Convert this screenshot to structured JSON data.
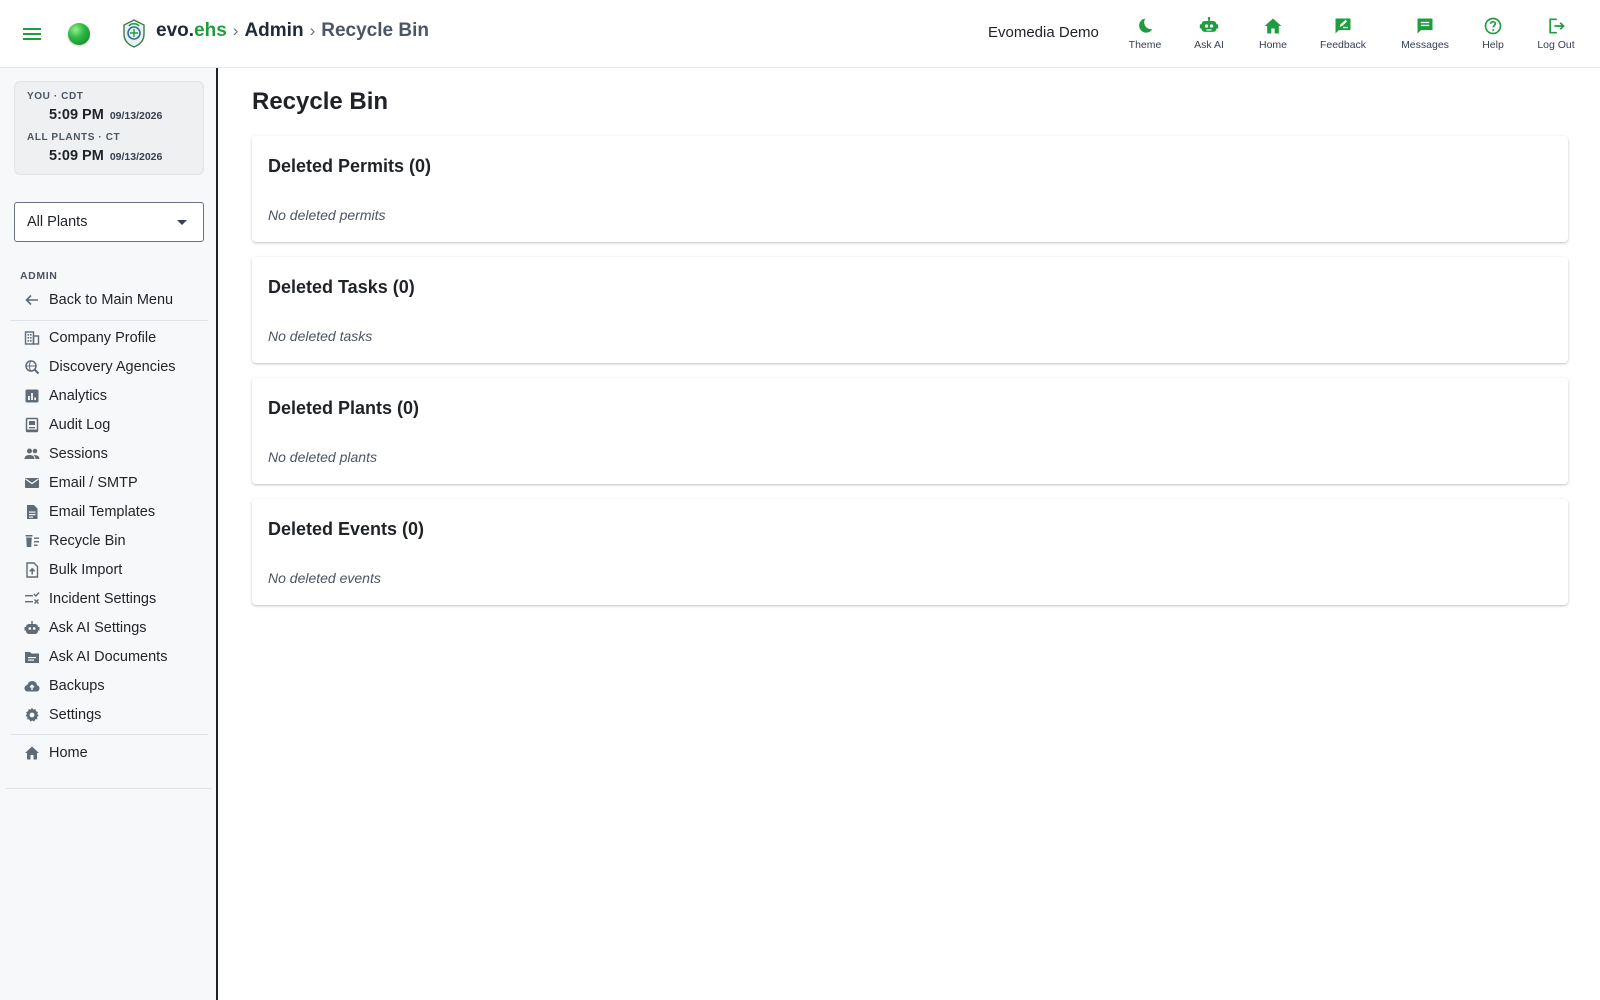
{
  "header": {
    "brand_primary": "evo.",
    "brand_accent": "ehs",
    "crumb_separator": "›",
    "breadcrumb": [
      "Admin",
      "Recycle Bin"
    ],
    "account": "Evomedia Demo",
    "actions": [
      {
        "label": "Theme",
        "icon": "moon-icon"
      },
      {
        "label": "Ask AI",
        "icon": "robot-icon"
      },
      {
        "label": "Home",
        "icon": "home-icon"
      },
      {
        "label": "Feedback",
        "icon": "feedback-icon"
      },
      {
        "label": "Messages",
        "icon": "message-icon"
      },
      {
        "label": "Help",
        "icon": "help-icon"
      },
      {
        "label": "Log Out",
        "icon": "logout-icon"
      }
    ]
  },
  "clock": {
    "you_label": "YOU · CDT",
    "you_time": "5:09 PM",
    "you_date": "09/13/2026",
    "plants_label": "ALL PLANTS · CT",
    "plants_time": "5:09 PM",
    "plants_date": "09/13/2026"
  },
  "plant_select": {
    "value": "All Plants"
  },
  "sidebar": {
    "section_label": "ADMIN",
    "back_label": "Back to Main Menu",
    "items": [
      {
        "label": "Company Profile",
        "icon": "building-icon"
      },
      {
        "label": "Discovery Agencies",
        "icon": "search-globe-icon"
      },
      {
        "label": "Analytics",
        "icon": "analytics-icon"
      },
      {
        "label": "Audit Log",
        "icon": "audit-log-icon"
      },
      {
        "label": "Sessions",
        "icon": "people-icon"
      },
      {
        "label": "Email / SMTP",
        "icon": "mail-icon"
      },
      {
        "label": "Email Templates",
        "icon": "document-icon"
      },
      {
        "label": "Recycle Bin",
        "icon": "recycle-bin-icon"
      },
      {
        "label": "Bulk Import",
        "icon": "upload-file-icon"
      },
      {
        "label": "Incident Settings",
        "icon": "checklist-icon"
      },
      {
        "label": "Ask AI Settings",
        "icon": "robot-icon"
      },
      {
        "label": "Ask AI Documents",
        "icon": "folder-icon"
      },
      {
        "label": "Backups",
        "icon": "cloud-upload-icon"
      },
      {
        "label": "Settings",
        "icon": "gear-icon"
      }
    ],
    "home_label": "Home"
  },
  "main": {
    "title": "Recycle Bin",
    "cards": [
      {
        "title": "Deleted Permits (0)",
        "empty": "No deleted permits"
      },
      {
        "title": "Deleted Tasks (0)",
        "empty": "No deleted tasks"
      },
      {
        "title": "Deleted Plants (0)",
        "empty": "No deleted plants"
      },
      {
        "title": "Deleted Events (0)",
        "empty": "No deleted events"
      }
    ]
  },
  "colors": {
    "accent": "#1f9d3e",
    "icon_gray": "#5f6b77"
  }
}
